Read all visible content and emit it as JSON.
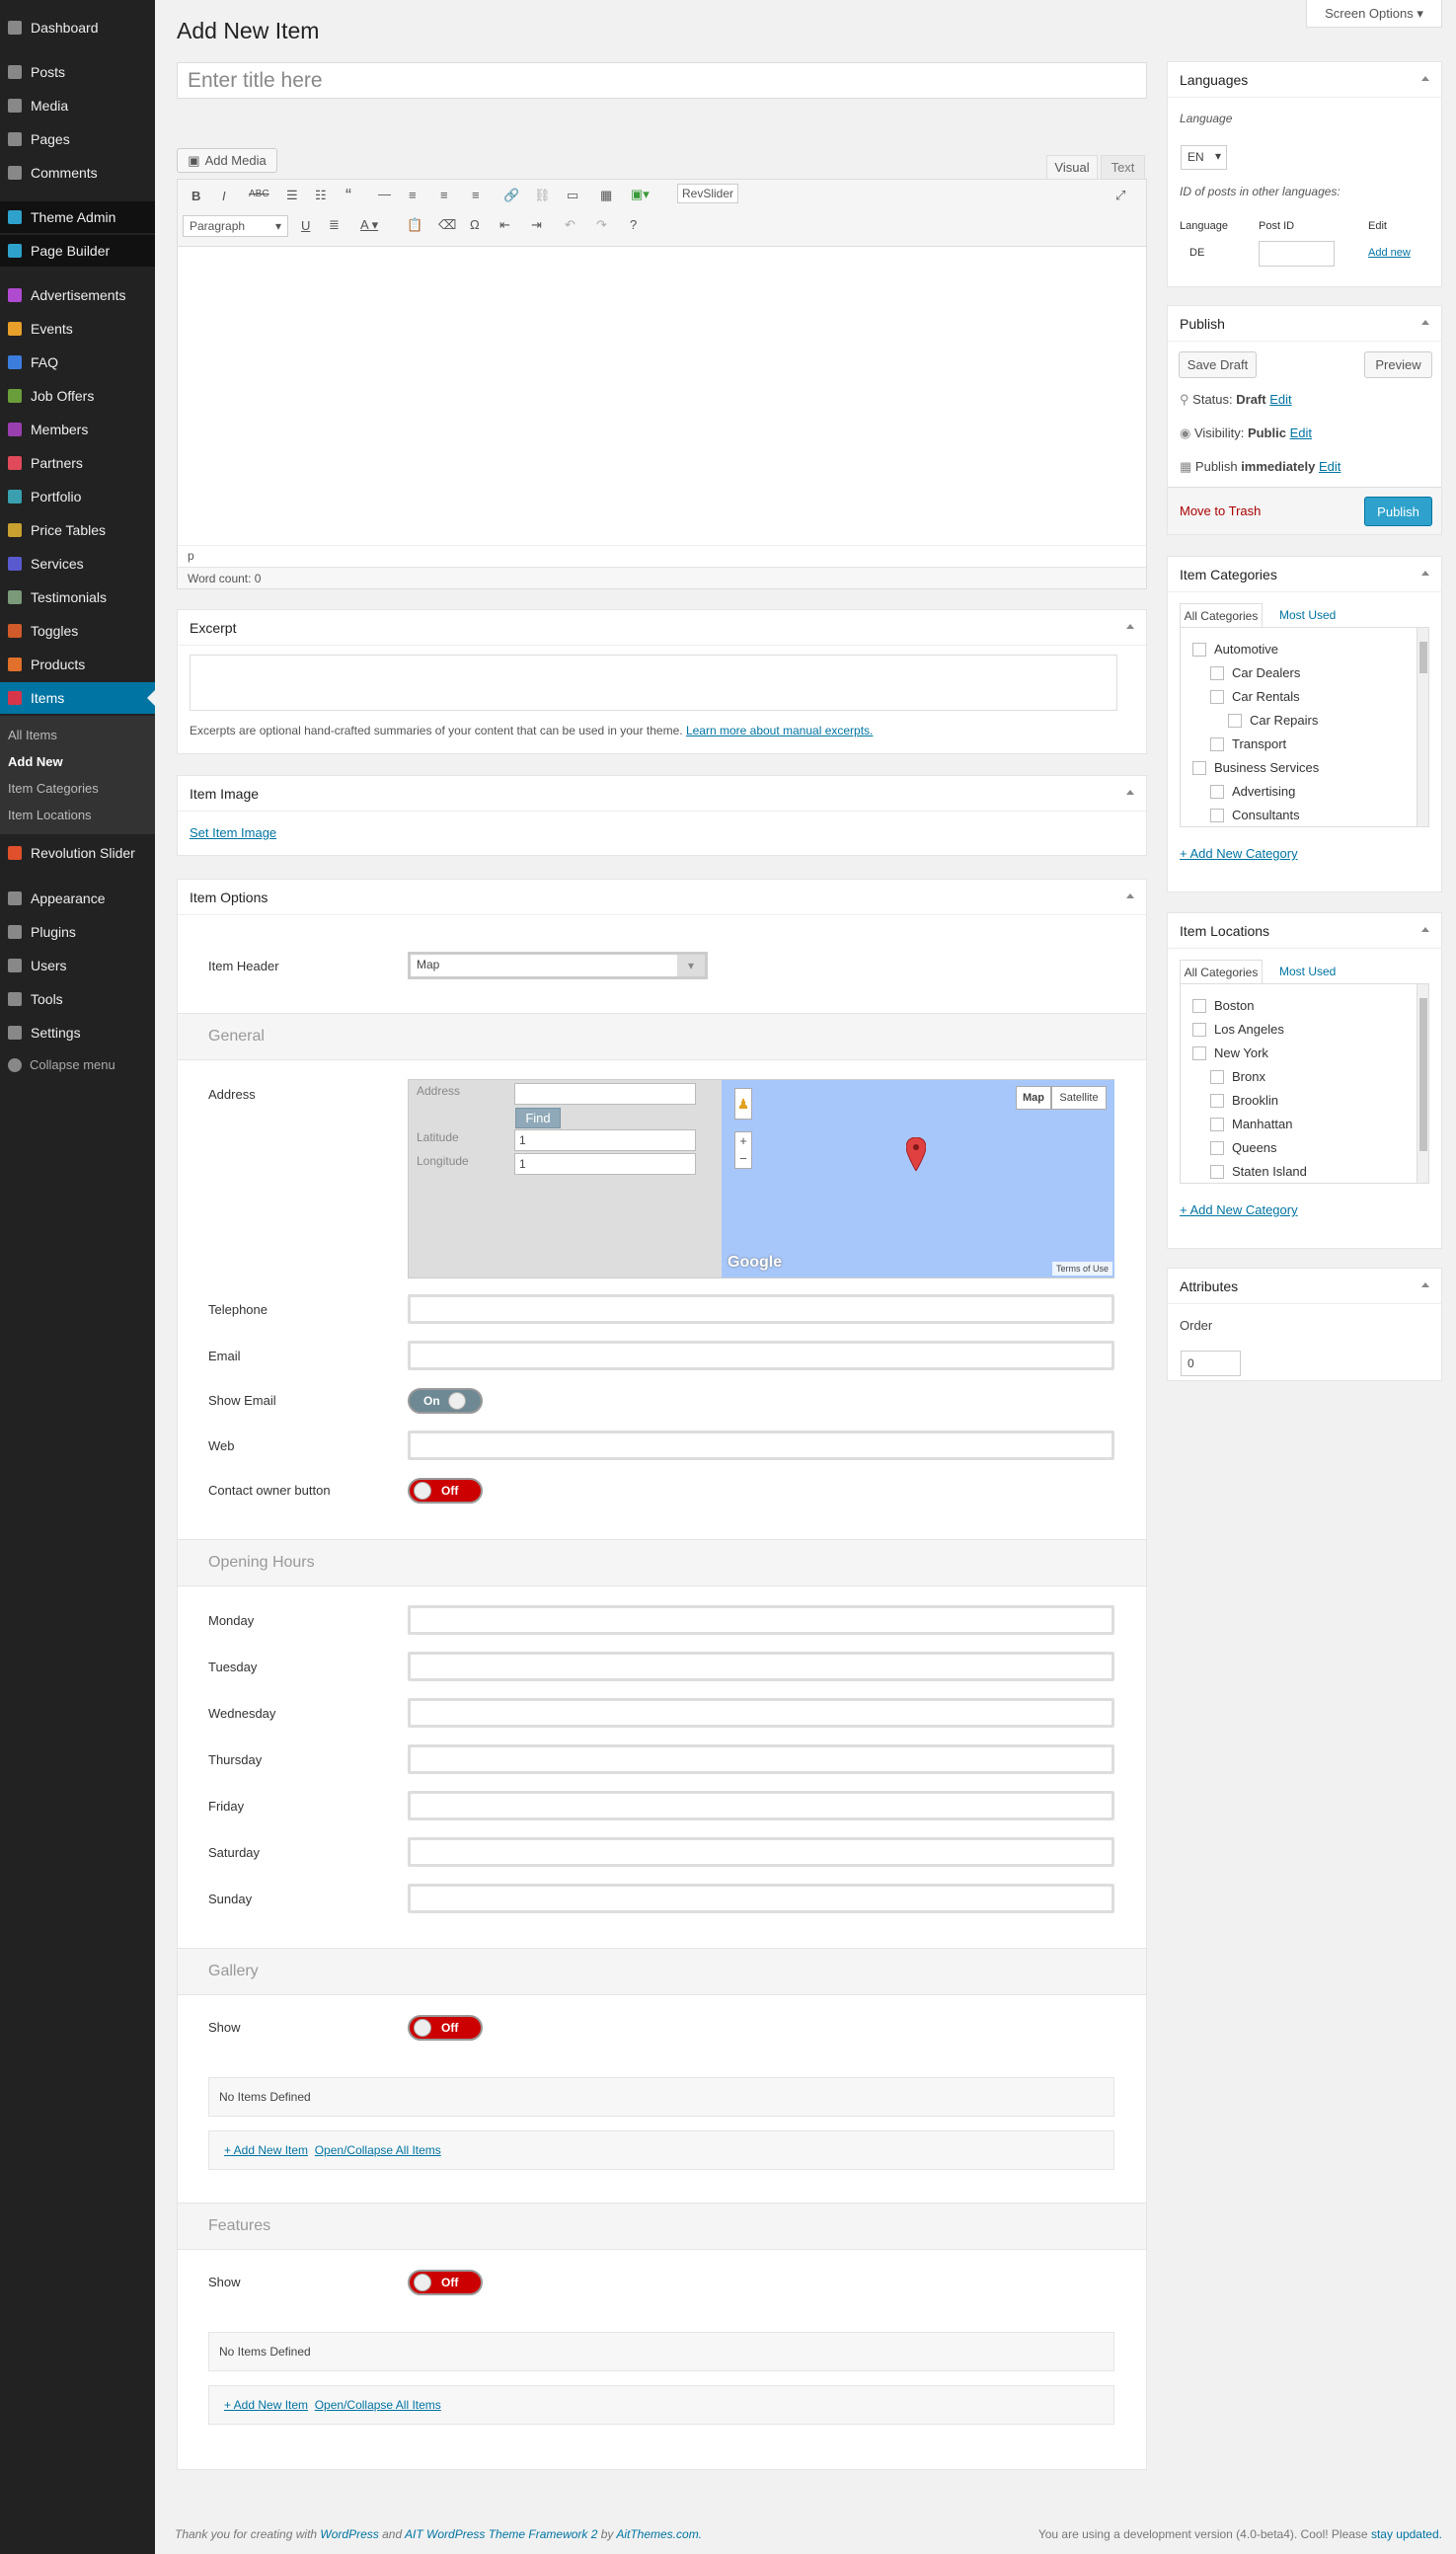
{
  "screen_options": "Screen Options",
  "page_title": "Add New Item",
  "title_placeholder": "Enter title here",
  "menu": [
    {
      "label": "Dashboard",
      "icon": "dashboard-icon"
    },
    {
      "label": "Posts",
      "icon": "pin-icon"
    },
    {
      "label": "Media",
      "icon": "media-icon"
    },
    {
      "label": "Pages",
      "icon": "page-icon"
    },
    {
      "label": "Comments",
      "icon": "comment-icon"
    },
    {
      "label": "Theme Admin",
      "icon": "theme-admin-icon"
    },
    {
      "label": "Page Builder",
      "icon": "page-builder-icon"
    },
    {
      "label": "Advertisements",
      "icon": "advertisement-icon"
    },
    {
      "label": "Events",
      "icon": "calendar-icon"
    },
    {
      "label": "FAQ",
      "icon": "question-icon"
    },
    {
      "label": "Job Offers",
      "icon": "job-icon"
    },
    {
      "label": "Members",
      "icon": "members-icon"
    },
    {
      "label": "Partners",
      "icon": "heart-icon"
    },
    {
      "label": "Portfolio",
      "icon": "portfolio-icon"
    },
    {
      "label": "Price Tables",
      "icon": "price-icon"
    },
    {
      "label": "Services",
      "icon": "services-icon"
    },
    {
      "label": "Testimonials",
      "icon": "testimonial-icon"
    },
    {
      "label": "Toggles",
      "icon": "toggle-icon"
    },
    {
      "label": "Products",
      "icon": "products-icon"
    },
    {
      "label": "Items",
      "icon": "items-icon"
    },
    {
      "label": "Revolution Slider",
      "icon": "slider-icon"
    },
    {
      "label": "Appearance",
      "icon": "brush-icon"
    },
    {
      "label": "Plugins",
      "icon": "plugin-icon"
    },
    {
      "label": "Users",
      "icon": "user-icon"
    },
    {
      "label": "Tools",
      "icon": "wrench-icon"
    },
    {
      "label": "Settings",
      "icon": "settings-icon"
    }
  ],
  "submenu": [
    "All Items",
    "Add New",
    "Item Categories",
    "Item Locations"
  ],
  "collapse_menu": "Collapse menu",
  "editor": {
    "add_media": "Add Media",
    "tab_visual": "Visual",
    "tab_text": "Text",
    "revslider": "RevSlider",
    "format": "Paragraph",
    "path": "p",
    "word_count": "Word count: 0"
  },
  "excerpt": {
    "title": "Excerpt",
    "help": "Excerpts are optional hand-crafted summaries of your content that can be used in your theme.",
    "help_link": "Learn more about manual excerpts."
  },
  "item_image": {
    "title": "Item Image",
    "link": "Set Item Image"
  },
  "item_options": {
    "title": "Item Options",
    "header_label": "Item Header",
    "header_value": "Map",
    "general": "General",
    "address_label": "Address",
    "map": {
      "address_label": "Address",
      "find": "Find",
      "latitude_label": "Latitude",
      "latitude_value": "1",
      "longitude_label": "Longitude",
      "longitude_value": "1",
      "map_btn": "Map",
      "satellite_btn": "Satellite",
      "google": "Google",
      "terms": "Terms of Use"
    },
    "telephone": "Telephone",
    "email": "Email",
    "show_email": "Show Email",
    "show_email_state": "On",
    "web": "Web",
    "contact_owner": "Contact owner button",
    "contact_owner_state": "Off",
    "opening_hours": "Opening Hours",
    "days": [
      "Monday",
      "Tuesday",
      "Wednesday",
      "Thursday",
      "Friday",
      "Saturday",
      "Sunday"
    ],
    "gallery": "Gallery",
    "gallery_show": "Show",
    "gallery_state": "Off",
    "gallery_empty": "No Items Defined",
    "features": "Features",
    "features_show": "Show",
    "features_state": "Off",
    "features_empty": "No Items Defined",
    "add_new_item": "+ Add New Item",
    "open_collapse": "Open/Collapse All Items"
  },
  "languages": {
    "title": "Languages",
    "label": "Language",
    "value": "EN",
    "other": "ID of posts in other languages:",
    "col_language": "Language",
    "col_post_id": "Post ID",
    "col_edit": "Edit",
    "row_lang": "DE",
    "row_add": "Add new"
  },
  "publish": {
    "title": "Publish",
    "save_draft": "Save Draft",
    "preview": "Preview",
    "status_label": "Status:",
    "status_value": "Draft",
    "visibility_label": "Visibility:",
    "visibility_value": "Public",
    "publish_label": "Publish",
    "publish_value": "immediately",
    "edit": "Edit",
    "trash": "Move to Trash",
    "publish_btn": "Publish"
  },
  "item_categories": {
    "title": "Item Categories",
    "tab_all": "All Categories",
    "tab_most": "Most Used",
    "items": [
      {
        "label": "Automotive",
        "level": 0
      },
      {
        "label": "Car Dealers",
        "level": 1
      },
      {
        "label": "Car Rentals",
        "level": 1
      },
      {
        "label": "Car Repairs",
        "level": 2
      },
      {
        "label": "Transport",
        "level": 1
      },
      {
        "label": "Business Services",
        "level": 0
      },
      {
        "label": "Advertising",
        "level": 1
      },
      {
        "label": "Consultants",
        "level": 1
      }
    ],
    "add": "+ Add New Category"
  },
  "item_locations": {
    "title": "Item Locations",
    "tab_all": "All Categories",
    "tab_most": "Most Used",
    "items": [
      {
        "label": "Boston",
        "level": 0
      },
      {
        "label": "Los Angeles",
        "level": 0
      },
      {
        "label": "New York",
        "level": 0
      },
      {
        "label": "Bronx",
        "level": 1
      },
      {
        "label": "Brooklin",
        "level": 1
      },
      {
        "label": "Manhattan",
        "level": 1
      },
      {
        "label": "Queens",
        "level": 1
      },
      {
        "label": "Staten Island",
        "level": 1
      }
    ],
    "add": "+ Add New Category"
  },
  "attributes": {
    "title": "Attributes",
    "order_label": "Order",
    "order_value": "0"
  },
  "footer": {
    "thanks_prefix": "Thank you for creating with",
    "wordpress": "WordPress",
    "and": "and",
    "framework": "AIT WordPress Theme Framework 2",
    "by": "by",
    "aitthemes": "AitThemes.com.",
    "version_text": "You are using a development version (4.0-beta4). Cool! Please",
    "stay_updated": "stay updated."
  },
  "colors": {
    "accent": "#0074a2",
    "publish_btn": "#2ea2cc",
    "toggle_off": "#cc0000",
    "sidebar": "#222222"
  }
}
